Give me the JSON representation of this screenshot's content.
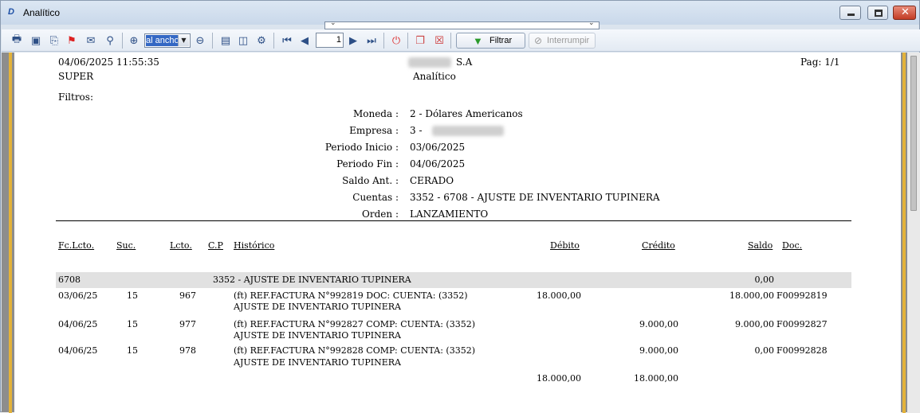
{
  "window": {
    "title": "Analítico",
    "app_icon": "app-logo-icon"
  },
  "toolbar": {
    "zoom_value": "al ancho",
    "page_number": "1",
    "filter_label": "Filtrar",
    "interrupt_label": "Interrumpir"
  },
  "report": {
    "datetime": "04/06/2025 11:55:35",
    "user": "SUPER",
    "company_suffix": "S.A",
    "report_title": "Analítico",
    "page": "Pag: 1/1",
    "filters_label": "Filtros:",
    "filters": [
      {
        "label": "Moneda :",
        "value": "2 - Dólares Americanos"
      },
      {
        "label": "Empresa :",
        "value": "3 -"
      },
      {
        "label": "Periodo Inicio :",
        "value": "03/06/2025"
      },
      {
        "label": "Periodo Fin :",
        "value": "04/06/2025"
      },
      {
        "label": "Saldo Ant. :",
        "value": "CERADO"
      },
      {
        "label": "Cuentas :",
        "value": "3352 - 6708 - AJUSTE DE INVENTARIO TUPINERA"
      },
      {
        "label": "Orden :",
        "value": "LANZAMIENTO"
      }
    ],
    "columns": {
      "fc_lcto": "Fc.Lcto.",
      "suc": "Suc.",
      "lcto": "Lcto.",
      "cp": "C.P",
      "historico": "Histórico",
      "debito": "Débito",
      "credito": "Crédito",
      "saldo": "Saldo",
      "doc": "Doc."
    },
    "group": {
      "account": "6708",
      "description": "3352 - AJUSTE DE INVENTARIO TUPINERA",
      "saldo": "0,00"
    },
    "rows": [
      {
        "fecha": "03/06/25",
        "suc": "15",
        "lcto": "967",
        "hist1": "(ft) REF.FACTURA N°992819 DOC: CUENTA: (3352)",
        "hist2": "AJUSTE DE INVENTARIO TUPINERA",
        "debito": "18.000,00",
        "credito": "",
        "saldo": "18.000,00",
        "doc": "F00992819"
      },
      {
        "fecha": "04/06/25",
        "suc": "15",
        "lcto": "977",
        "hist1": "(ft) REF.FACTURA N°992827 COMP: CUENTA: (3352)",
        "hist2": "AJUSTE DE INVENTARIO TUPINERA",
        "debito": "",
        "credito": "9.000,00",
        "saldo": "9.000,00",
        "doc": "F00992827"
      },
      {
        "fecha": "04/06/25",
        "suc": "15",
        "lcto": "978",
        "hist1": "(ft) REF.FACTURA N°992828 COMP: CUENTA: (3352)",
        "hist2": "AJUSTE DE INVENTARIO TUPINERA",
        "debito": "",
        "credito": "9.000,00",
        "saldo": "0,00",
        "doc": "F00992828"
      }
    ],
    "totals": {
      "debito": "18.000,00",
      "credito": "18.000,00"
    }
  }
}
